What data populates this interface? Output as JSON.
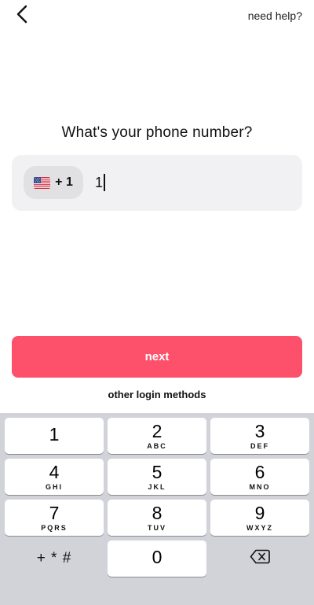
{
  "header": {
    "back_icon": "chevron-left-icon",
    "help_link": "need help?"
  },
  "main": {
    "question": "What's your phone number?",
    "country": {
      "flag_icon": "us-flag-icon",
      "code": "+ 1"
    },
    "phone_value": "1",
    "next_label": "next",
    "other_login_label": "other login methods"
  },
  "keypad": {
    "keys": [
      {
        "digit": "1",
        "letters": ""
      },
      {
        "digit": "2",
        "letters": "ABC"
      },
      {
        "digit": "3",
        "letters": "DEF"
      },
      {
        "digit": "4",
        "letters": "GHI"
      },
      {
        "digit": "5",
        "letters": "JKL"
      },
      {
        "digit": "6",
        "letters": "MNO"
      },
      {
        "digit": "7",
        "letters": "PQRS"
      },
      {
        "digit": "8",
        "letters": "TUV"
      },
      {
        "digit": "9",
        "letters": "WXYZ"
      },
      {
        "digit": "0",
        "letters": ""
      }
    ],
    "symbols_label": "+ * #",
    "delete_icon": "backspace-icon"
  },
  "colors": {
    "accent": "#fd506a",
    "keyboard_bg": "#d1d3d9",
    "input_bg": "#f1f1f3"
  }
}
